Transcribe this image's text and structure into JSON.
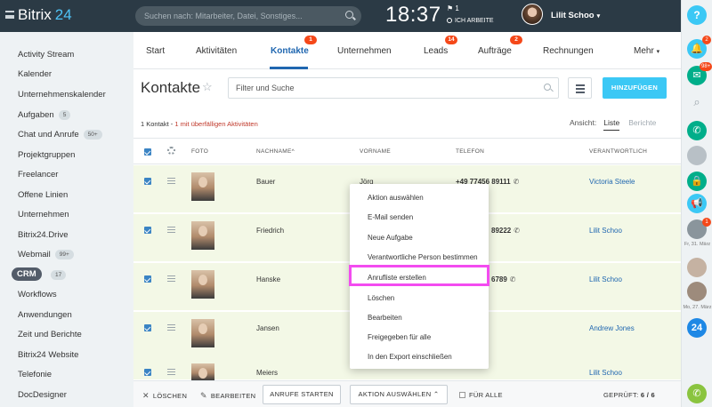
{
  "topbar": {
    "logo_name": "Bitrix",
    "logo_number": "24",
    "search_placeholder": "Suchen nach: Mitarbeiter, Datei, Sonstiges...",
    "clock": "18:37",
    "flag_count": "1",
    "work_status": "ICH ARBEITE",
    "user_name": "Lilit Schoo"
  },
  "leftnav": {
    "items": [
      {
        "label": "Activity Stream",
        "badge": ""
      },
      {
        "label": "Kalender",
        "badge": ""
      },
      {
        "label": "Unternehmenskalender",
        "badge": ""
      },
      {
        "label": "Aufgaben",
        "badge": "5"
      },
      {
        "label": "Chat und Anrufe",
        "badge": "50+"
      },
      {
        "label": "Projektgruppen",
        "badge": ""
      },
      {
        "label": "Freelancer",
        "badge": ""
      },
      {
        "label": "Offene Linien",
        "badge": ""
      },
      {
        "label": "Unternehmen",
        "badge": ""
      },
      {
        "label": "Bitrix24.Drive",
        "badge": ""
      },
      {
        "label": "Webmail",
        "badge": "99+"
      },
      {
        "label": "CRM",
        "badge": "17"
      },
      {
        "label": "Workflows",
        "badge": ""
      },
      {
        "label": "Anwendungen",
        "badge": ""
      },
      {
        "label": "Zeit und Berichte",
        "badge": ""
      },
      {
        "label": "Bitrix24 Website",
        "badge": ""
      },
      {
        "label": "Telefonie",
        "badge": ""
      },
      {
        "label": "DocDesigner",
        "badge": ""
      }
    ]
  },
  "tabs": [
    {
      "label": "Start",
      "badge": ""
    },
    {
      "label": "Aktivitäten",
      "badge": ""
    },
    {
      "label": "Kontakte",
      "badge": "1"
    },
    {
      "label": "Unternehmen",
      "badge": ""
    },
    {
      "label": "Leads",
      "badge": "14"
    },
    {
      "label": "Aufträge",
      "badge": "2"
    },
    {
      "label": "Rechnungen",
      "badge": ""
    },
    {
      "label": "Mehr",
      "badge": ""
    }
  ],
  "toolbar": {
    "title": "Kontakte",
    "filter_placeholder": "Filter und Suche",
    "add_label": "HINZUFÜGEN"
  },
  "summary": {
    "count": "1 Kontakt",
    "separator": " - ",
    "overdue": "1 mit überfälligen Aktivitäten",
    "view_label": "Ansicht:",
    "view_list": "Liste",
    "view_reports": "Berichte"
  },
  "table": {
    "columns": [
      "FOTO",
      "NACHNAME",
      "VORNAME",
      "TELEFON",
      "VERANTWORTLICH"
    ],
    "rows": [
      {
        "lastname": "Bauer",
        "firstname": "Jörg",
        "phone": "+49 77456 89111",
        "responsible": "Victoria Steele"
      },
      {
        "lastname": "Friedrich",
        "firstname": "",
        "phone": "89222",
        "responsible": "Lilit Schoo"
      },
      {
        "lastname": "Hanske",
        "firstname": "",
        "phone": "6789",
        "responsible": "Lilit Schoo"
      },
      {
        "lastname": "Jansen",
        "firstname": "",
        "phone": "",
        "responsible": "Andrew Jones"
      },
      {
        "lastname": "Meiers",
        "firstname": "",
        "phone": "",
        "responsible": "Lilit Schoo"
      }
    ]
  },
  "context_menu": {
    "items": [
      "Aktion auswählen",
      "E-Mail senden",
      "Neue Aufgabe",
      "Verantwortliche Person bestimmen",
      "Anrufliste erstellen",
      "Löschen",
      "Bearbeiten",
      "Freigegeben für alle",
      "In den Export einschließen"
    ]
  },
  "bottombar": {
    "delete": "LÖSCHEN",
    "edit": "BEARBEITEN",
    "start_calls": "ANRUFE STARTEN",
    "action_select": "AKTION AUSWÄHLEN",
    "for_all": "FÜR ALLE",
    "checked_label": "GEPRÜFT:",
    "checked_value": "6 / 6"
  },
  "rightbar": {
    "help": "?",
    "badge_1": "2",
    "badge_2": "98+",
    "badge_3": "1",
    "date_1": "Fr, 31. März",
    "date_2": "Mo, 27. März",
    "b24": "24"
  },
  "colors": {
    "accent": "#2067b0",
    "add_button": "#3bc8f5",
    "row_highlight": "#f3f8e6",
    "menu_highlight": "#f34cf0",
    "badge_red": "#f54819"
  }
}
